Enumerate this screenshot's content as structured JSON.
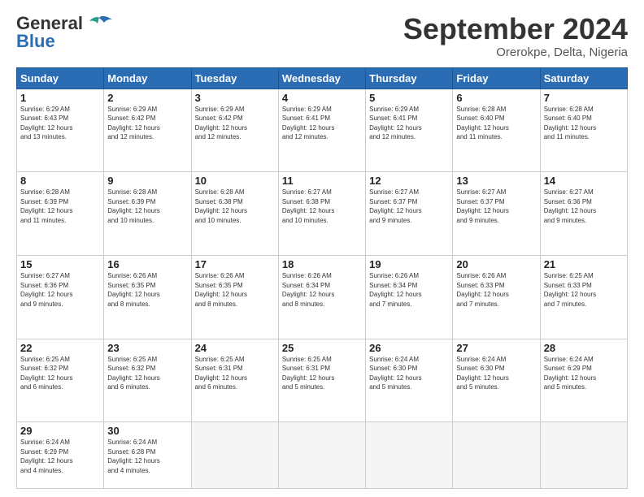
{
  "header": {
    "logo_general": "General",
    "logo_blue": "Blue",
    "title": "September 2024",
    "location": "Orerokpe, Delta, Nigeria"
  },
  "columns": [
    "Sunday",
    "Monday",
    "Tuesday",
    "Wednesday",
    "Thursday",
    "Friday",
    "Saturday"
  ],
  "weeks": [
    [
      {
        "day": "1",
        "sunrise": "6:29 AM",
        "sunset": "6:43 PM",
        "daylight": "12 hours and 13 minutes."
      },
      {
        "day": "2",
        "sunrise": "6:29 AM",
        "sunset": "6:42 PM",
        "daylight": "12 hours and 12 minutes."
      },
      {
        "day": "3",
        "sunrise": "6:29 AM",
        "sunset": "6:42 PM",
        "daylight": "12 hours and 12 minutes."
      },
      {
        "day": "4",
        "sunrise": "6:29 AM",
        "sunset": "6:41 PM",
        "daylight": "12 hours and 12 minutes."
      },
      {
        "day": "5",
        "sunrise": "6:29 AM",
        "sunset": "6:41 PM",
        "daylight": "12 hours and 12 minutes."
      },
      {
        "day": "6",
        "sunrise": "6:28 AM",
        "sunset": "6:40 PM",
        "daylight": "12 hours and 11 minutes."
      },
      {
        "day": "7",
        "sunrise": "6:28 AM",
        "sunset": "6:40 PM",
        "daylight": "12 hours and 11 minutes."
      }
    ],
    [
      {
        "day": "8",
        "sunrise": "6:28 AM",
        "sunset": "6:39 PM",
        "daylight": "12 hours and 11 minutes."
      },
      {
        "day": "9",
        "sunrise": "6:28 AM",
        "sunset": "6:39 PM",
        "daylight": "12 hours and 10 minutes."
      },
      {
        "day": "10",
        "sunrise": "6:28 AM",
        "sunset": "6:38 PM",
        "daylight": "12 hours and 10 minutes."
      },
      {
        "day": "11",
        "sunrise": "6:27 AM",
        "sunset": "6:38 PM",
        "daylight": "12 hours and 10 minutes."
      },
      {
        "day": "12",
        "sunrise": "6:27 AM",
        "sunset": "6:37 PM",
        "daylight": "12 hours and 9 minutes."
      },
      {
        "day": "13",
        "sunrise": "6:27 AM",
        "sunset": "6:37 PM",
        "daylight": "12 hours and 9 minutes."
      },
      {
        "day": "14",
        "sunrise": "6:27 AM",
        "sunset": "6:36 PM",
        "daylight": "12 hours and 9 minutes."
      }
    ],
    [
      {
        "day": "15",
        "sunrise": "6:27 AM",
        "sunset": "6:36 PM",
        "daylight": "12 hours and 9 minutes."
      },
      {
        "day": "16",
        "sunrise": "6:26 AM",
        "sunset": "6:35 PM",
        "daylight": "12 hours and 8 minutes."
      },
      {
        "day": "17",
        "sunrise": "6:26 AM",
        "sunset": "6:35 PM",
        "daylight": "12 hours and 8 minutes."
      },
      {
        "day": "18",
        "sunrise": "6:26 AM",
        "sunset": "6:34 PM",
        "daylight": "12 hours and 8 minutes."
      },
      {
        "day": "19",
        "sunrise": "6:26 AM",
        "sunset": "6:34 PM",
        "daylight": "12 hours and 7 minutes."
      },
      {
        "day": "20",
        "sunrise": "6:26 AM",
        "sunset": "6:33 PM",
        "daylight": "12 hours and 7 minutes."
      },
      {
        "day": "21",
        "sunrise": "6:25 AM",
        "sunset": "6:33 PM",
        "daylight": "12 hours and 7 minutes."
      }
    ],
    [
      {
        "day": "22",
        "sunrise": "6:25 AM",
        "sunset": "6:32 PM",
        "daylight": "12 hours and 6 minutes."
      },
      {
        "day": "23",
        "sunrise": "6:25 AM",
        "sunset": "6:32 PM",
        "daylight": "12 hours and 6 minutes."
      },
      {
        "day": "24",
        "sunrise": "6:25 AM",
        "sunset": "6:31 PM",
        "daylight": "12 hours and 6 minutes."
      },
      {
        "day": "25",
        "sunrise": "6:25 AM",
        "sunset": "6:31 PM",
        "daylight": "12 hours and 5 minutes."
      },
      {
        "day": "26",
        "sunrise": "6:24 AM",
        "sunset": "6:30 PM",
        "daylight": "12 hours and 5 minutes."
      },
      {
        "day": "27",
        "sunrise": "6:24 AM",
        "sunset": "6:30 PM",
        "daylight": "12 hours and 5 minutes."
      },
      {
        "day": "28",
        "sunrise": "6:24 AM",
        "sunset": "6:29 PM",
        "daylight": "12 hours and 5 minutes."
      }
    ],
    [
      {
        "day": "29",
        "sunrise": "6:24 AM",
        "sunset": "6:29 PM",
        "daylight": "12 hours and 4 minutes."
      },
      {
        "day": "30",
        "sunrise": "6:24 AM",
        "sunset": "6:28 PM",
        "daylight": "12 hours and 4 minutes."
      },
      null,
      null,
      null,
      null,
      null
    ]
  ]
}
